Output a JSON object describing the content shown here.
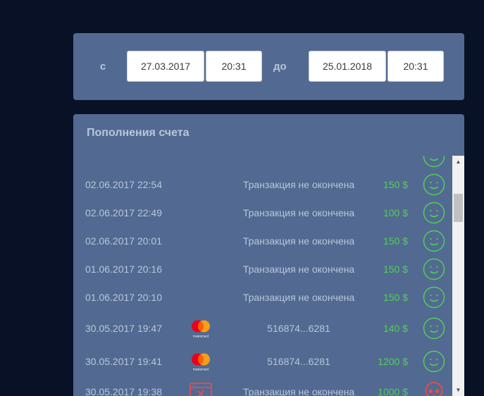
{
  "filter": {
    "from_label": "с",
    "from_date": "27.03.2017",
    "from_time": "20:31",
    "to_label": "до",
    "to_date": "25.01.2018",
    "to_time": "20:31"
  },
  "deposits": {
    "title": "Пополнения счета",
    "rows": [
      {
        "date": "02.06.2017 22:54",
        "icon": "none",
        "description": "Транзакция не окончена",
        "amount": "150 $",
        "status": "smiley-icon"
      },
      {
        "date": "02.06.2017 22:49",
        "icon": "none",
        "description": "Транзакция не окончена",
        "amount": "100 $",
        "status": "smiley-icon"
      },
      {
        "date": "02.06.2017 20:01",
        "icon": "none",
        "description": "Транзакция не окончена",
        "amount": "150 $",
        "status": "smiley-icon"
      },
      {
        "date": "01.06.2017 20:16",
        "icon": "none",
        "description": "Транзакция не окончена",
        "amount": "150 $",
        "status": "smiley-icon"
      },
      {
        "date": "01.06.2017 20:10",
        "icon": "none",
        "description": "Транзакция не окончена",
        "amount": "150 $",
        "status": "smiley-icon"
      },
      {
        "date": "30.05.2017 19:47",
        "icon": "mastercard-icon",
        "description": "516874...6281",
        "amount": "140 $",
        "status": "smiley-icon"
      },
      {
        "date": "30.05.2017 19:41",
        "icon": "mastercard-icon",
        "description": "516874...6281",
        "amount": "1200 $",
        "status": "smiley-icon"
      },
      {
        "date": "30.05.2017 19:38",
        "icon": "window-error-icon",
        "description": "Транзакция не окончена",
        "amount": "1000 $",
        "status": "skull-icon"
      }
    ],
    "mastercard_caption": "mastercard"
  },
  "colors": {
    "background": "#081126",
    "panel": "#526a91",
    "text": "#b9c6dc",
    "amount": "#4fcf56",
    "error": "#e94b4b"
  },
  "scrollbar": {
    "up_icon": "arrow-up-icon",
    "down_icon": "arrow-down-icon"
  }
}
